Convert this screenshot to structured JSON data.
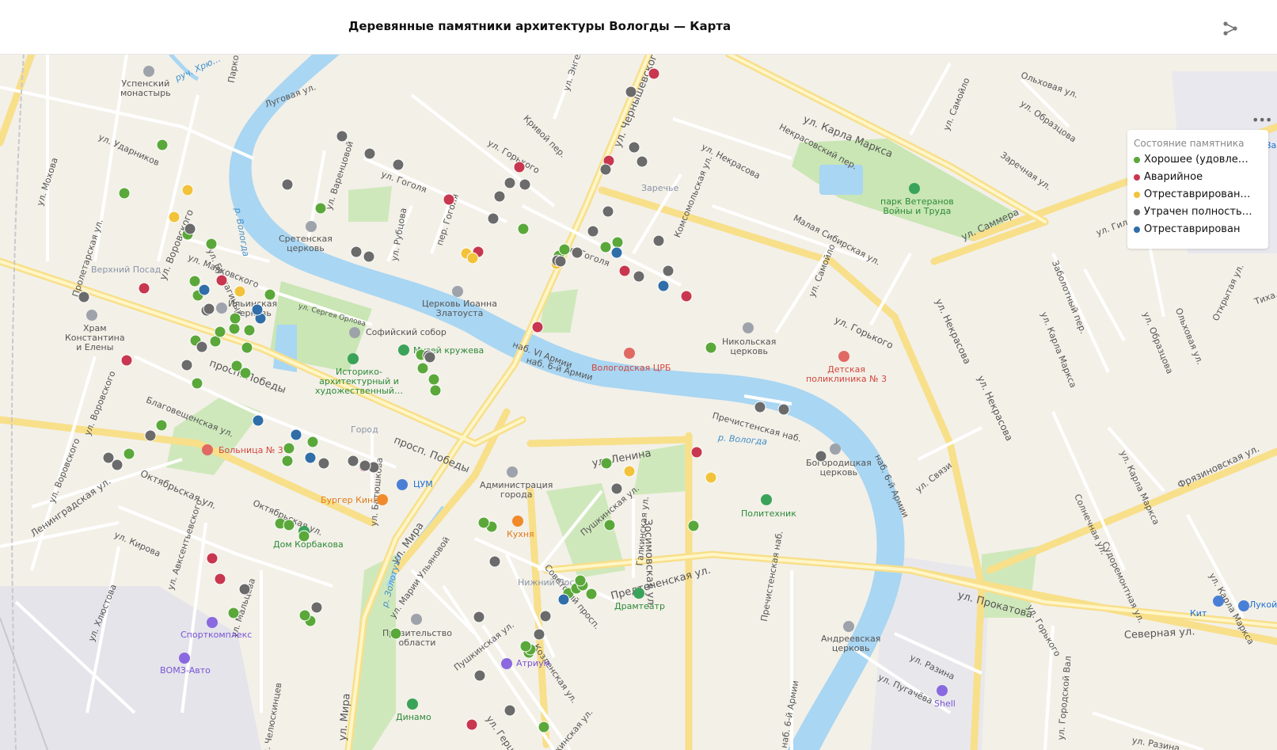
{
  "header": {
    "title": "Деревянные памятники архитектуры Вологды — Карта"
  },
  "legend": {
    "title": "Состояние памятника",
    "items": [
      {
        "label": "Хорошее (удовле…",
        "color": "#5aa83a"
      },
      {
        "label": "Аварийное",
        "color": "#c8374f"
      },
      {
        "label": "Отреставрирован…",
        "color": "#f2c33a"
      },
      {
        "label": "Утрачен полность…",
        "color": "#6b6b6b"
      },
      {
        "label": "Отреставрирован",
        "color": "#2f6ea8"
      }
    ]
  },
  "streets": [
    {
      "t": "ул. Карла Маркса"
    },
    {
      "t": "ул. Чернышевского"
    },
    {
      "t": "просп. Победы"
    },
    {
      "t": "просп. Победы"
    },
    {
      "t": "Октябрьская ул."
    },
    {
      "t": "ул. Мира"
    },
    {
      "t": "ул. Мира"
    },
    {
      "t": "ул. Ленина"
    },
    {
      "t": "Предтеченская ул."
    },
    {
      "t": "ул. Прокатова"
    },
    {
      "t": "Северная ул."
    },
    {
      "t": "Зосимовская ул."
    },
    {
      "t": "ул. Горького"
    },
    {
      "t": "ул. Саммера"
    },
    {
      "t": "ул. Некрасова"
    },
    {
      "t": "ул. Некрасова"
    },
    {
      "t": "Благовещенская ул."
    },
    {
      "t": "Ленинградская ул."
    },
    {
      "t": "ул. Маяковского"
    },
    {
      "t": "ул. Воровского"
    },
    {
      "t": "ул. Воровского"
    },
    {
      "t": "ул. Воровского"
    },
    {
      "t": "ул. Гоголя"
    },
    {
      "t": "ул. Гоголя"
    },
    {
      "t": "ул. Горького"
    },
    {
      "t": "Некрасовский пер."
    },
    {
      "t": "ул. Некрасова"
    },
    {
      "t": "Малая Сибирская ул."
    },
    {
      "t": "Комсомольская ул."
    },
    {
      "t": "ул. Самойло"
    },
    {
      "t": "ул. Самойло"
    },
    {
      "t": "ул. Образцова"
    },
    {
      "t": "Заречная ул."
    },
    {
      "t": "Ольховая ул."
    },
    {
      "t": "ул. Гиляровского"
    },
    {
      "t": "Заболотный пер."
    },
    {
      "t": "ул. Карла Маркса"
    },
    {
      "t": "ул. Карла Маркса"
    },
    {
      "t": "ул. Карла Маркса"
    },
    {
      "t": "Солнечная ул."
    },
    {
      "t": "Судоремонтная ул."
    },
    {
      "t": "Фрязиновская ул."
    },
    {
      "t": "ул. Связи"
    },
    {
      "t": "наб. 6-й Армии"
    },
    {
      "t": "наб. 6-й Армии"
    },
    {
      "t": "наб. 6-й Армии"
    },
    {
      "t": "Пречистенская наб."
    },
    {
      "t": "Пречистенская наб."
    },
    {
      "t": "ул. Разина"
    },
    {
      "t": "ул. Пугачёва"
    },
    {
      "t": "ул. Разина"
    },
    {
      "t": "ул. Городской Вал"
    },
    {
      "t": "ул. Горького"
    },
    {
      "t": "Галкинская ул."
    },
    {
      "t": "Галкинская ул."
    },
    {
      "t": "Пушкинская ул."
    },
    {
      "t": "Пушкинская ул."
    },
    {
      "t": "Советский просп."
    },
    {
      "t": "Козленская ул."
    },
    {
      "t": "ул. Герцена"
    },
    {
      "t": "ул. Марии Ульяновой"
    },
    {
      "t": "ул. Батюшкова"
    },
    {
      "t": "Октябрьская ул."
    },
    {
      "t": "ул. Кирова"
    },
    {
      "t": "ул. Хлюстова"
    },
    {
      "t": "ул. Авксентьевского"
    },
    {
      "t": "ул. Мальцева"
    },
    {
      "t": "ул. Челюскинцев"
    },
    {
      "t": "ул. Мохова"
    },
    {
      "t": "ул. Ударников"
    },
    {
      "t": "Пролетарская ул."
    },
    {
      "t": "ул. Бурмагиных"
    },
    {
      "t": "Луговая ул."
    },
    {
      "t": "Парковый пер."
    },
    {
      "t": "ул. Энгельса"
    },
    {
      "t": "Кривой пер."
    },
    {
      "t": "ул. Варенцовой"
    },
    {
      "t": "ул. Рубцова"
    },
    {
      "t": "пер. Гоголя"
    },
    {
      "t": "ул. Сергея Орлова"
    },
    {
      "t": "наб. VI Армии"
    },
    {
      "t": "руч. Хрю…"
    },
    {
      "t": "р. Вологда"
    },
    {
      "t": "р. Вологда"
    },
    {
      "t": "р. Золотуха"
    },
    {
      "t": "Ольховая ул."
    },
    {
      "t": "ул. Образцова"
    },
    {
      "t": "Открытая ул."
    },
    {
      "t": "Тиха…"
    }
  ],
  "places": [
    {
      "t": "Успенский\nмонастырь"
    },
    {
      "t": "Сретенская\nцерковь"
    },
    {
      "t": "Верхний Посад"
    },
    {
      "t": "Храм\nКонстантина\nи Елены"
    },
    {
      "t": "Ильинская\nцерковь"
    },
    {
      "t": "Церковь Иоанна\nЗлатоуста"
    },
    {
      "t": "Софийский собор"
    },
    {
      "t": "Музей кружева"
    },
    {
      "t": "Историко-\nархитектурный и\nхудожественный…"
    },
    {
      "t": "Вологодская ЦРБ"
    },
    {
      "t": "Никольская\nцерковь"
    },
    {
      "t": "Детская\nполиклиника № 3"
    },
    {
      "t": "Заречье"
    },
    {
      "t": "парк Ветеранов\nВойны и Труда"
    },
    {
      "t": "Больница № 3"
    },
    {
      "t": "Город"
    },
    {
      "t": "ЦУМ"
    },
    {
      "t": "Бургер Кинг"
    },
    {
      "t": "Администрация\nгорода"
    },
    {
      "t": "Кухня"
    },
    {
      "t": "Дом Корбакова"
    },
    {
      "t": "Богородицкая\nцерковь"
    },
    {
      "t": "Политехник"
    },
    {
      "t": "Нижний Посад"
    },
    {
      "t": "Драмтеатр"
    },
    {
      "t": "Спорткомплекс"
    },
    {
      "t": "ВОМЗ-Авто"
    },
    {
      "t": "Правительство\nобласти"
    },
    {
      "t": "Атриум"
    },
    {
      "t": "Андреевская\nцерковь"
    },
    {
      "t": "Динамо"
    },
    {
      "t": "Shell"
    },
    {
      "t": "Кит"
    },
    {
      "t": "Лукой…"
    },
    {
      "t": "Ва…"
    }
  ],
  "markers": [
    {
      "s": 0,
      "lat": -1
    },
    {
      "s": 0
    },
    {
      "s": 0
    },
    {
      "s": 0
    },
    {
      "s": 0
    },
    {
      "s": 0
    },
    {
      "s": 0
    },
    {
      "s": 0
    },
    {
      "s": 0
    },
    {
      "s": 0
    },
    {
      "s": 0
    },
    {
      "s": 0
    },
    {
      "s": 0
    },
    {
      "s": 0
    },
    {
      "s": 0
    },
    {
      "s": 0
    },
    {
      "s": 0
    },
    {
      "s": 0
    },
    {
      "s": 0
    },
    {
      "s": 0
    },
    {
      "s": 0
    },
    {
      "s": 0
    },
    {
      "s": 0
    },
    {
      "s": 0
    },
    {
      "s": 0
    },
    {
      "s": 0
    },
    {
      "s": 0
    },
    {
      "s": 0
    },
    {
      "s": 0
    },
    {
      "s": 0
    },
    {
      "s": 0
    },
    {
      "s": 0
    },
    {
      "s": 0
    },
    {
      "s": 0
    },
    {
      "s": 0
    },
    {
      "s": 0
    },
    {
      "s": 0
    },
    {
      "s": 0
    },
    {
      "s": 0
    },
    {
      "s": 0
    },
    {
      "s": 1
    },
    {
      "s": 1
    },
    {
      "s": 1
    },
    {
      "s": 1
    },
    {
      "s": 1
    },
    {
      "s": 1
    },
    {
      "s": 1
    },
    {
      "s": 1
    },
    {
      "s": 1
    },
    {
      "s": 1
    },
    {
      "s": 1
    },
    {
      "s": 1
    },
    {
      "s": 1
    },
    {
      "s": 1
    },
    {
      "s": 1
    },
    {
      "s": 2
    },
    {
      "s": 2
    },
    {
      "s": 2
    },
    {
      "s": 2
    },
    {
      "s": 2
    },
    {
      "s": 2
    },
    {
      "s": 2
    },
    {
      "s": 2
    },
    {
      "s": 2
    },
    {
      "s": 3
    },
    {
      "s": 3
    },
    {
      "s": 3
    },
    {
      "s": 3
    },
    {
      "s": 3
    },
    {
      "s": 3
    },
    {
      "s": 3
    },
    {
      "s": 3
    },
    {
      "s": 3
    },
    {
      "s": 3
    },
    {
      "s": 3
    },
    {
      "s": 3
    },
    {
      "s": 3
    },
    {
      "s": 3
    },
    {
      "s": 3
    },
    {
      "s": 3
    },
    {
      "s": 3
    },
    {
      "s": 3
    },
    {
      "s": 3
    },
    {
      "s": 3
    },
    {
      "s": 3
    },
    {
      "s": 3
    },
    {
      "s": 3
    },
    {
      "s": 3
    },
    {
      "s": 3
    },
    {
      "s": 3
    },
    {
      "s": 3
    },
    {
      "s": 3
    },
    {
      "s": 3
    },
    {
      "s": 3
    },
    {
      "s": 3
    },
    {
      "s": 3
    },
    {
      "s": 3
    },
    {
      "s": 3
    },
    {
      "s": 3
    },
    {
      "s": 3
    },
    {
      "s": 3
    },
    {
      "s": 3
    },
    {
      "s": 3
    },
    {
      "s": 3
    },
    {
      "s": 4
    },
    {
      "s": 4
    },
    {
      "s": 4
    },
    {
      "s": 4
    },
    {
      "s": 4
    },
    {
      "s": 4
    },
    {
      "s": 4
    },
    {
      "s": 4
    },
    {
      "s": 4
    }
  ]
}
